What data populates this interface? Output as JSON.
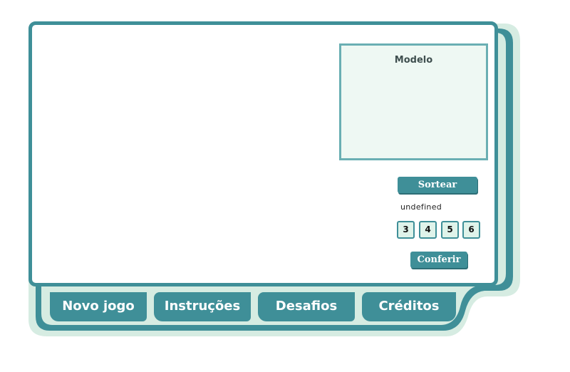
{
  "modelo": {
    "title": "Modelo"
  },
  "controls": {
    "sortear_label": "Sortear",
    "status_text": "undefined",
    "numbers": [
      "3",
      "4",
      "5",
      "6"
    ],
    "conferir_label": "Conferir"
  },
  "nav": {
    "tabs": [
      {
        "label": "Novo jogo"
      },
      {
        "label": "Instruções"
      },
      {
        "label": "Desafios"
      },
      {
        "label": "Créditos"
      }
    ]
  },
  "colors": {
    "frame_teal": "#3f8f98",
    "frame_mint": "#d6ece2",
    "panel_bg": "#ffffff",
    "modelo_bg": "#eef8f3"
  }
}
